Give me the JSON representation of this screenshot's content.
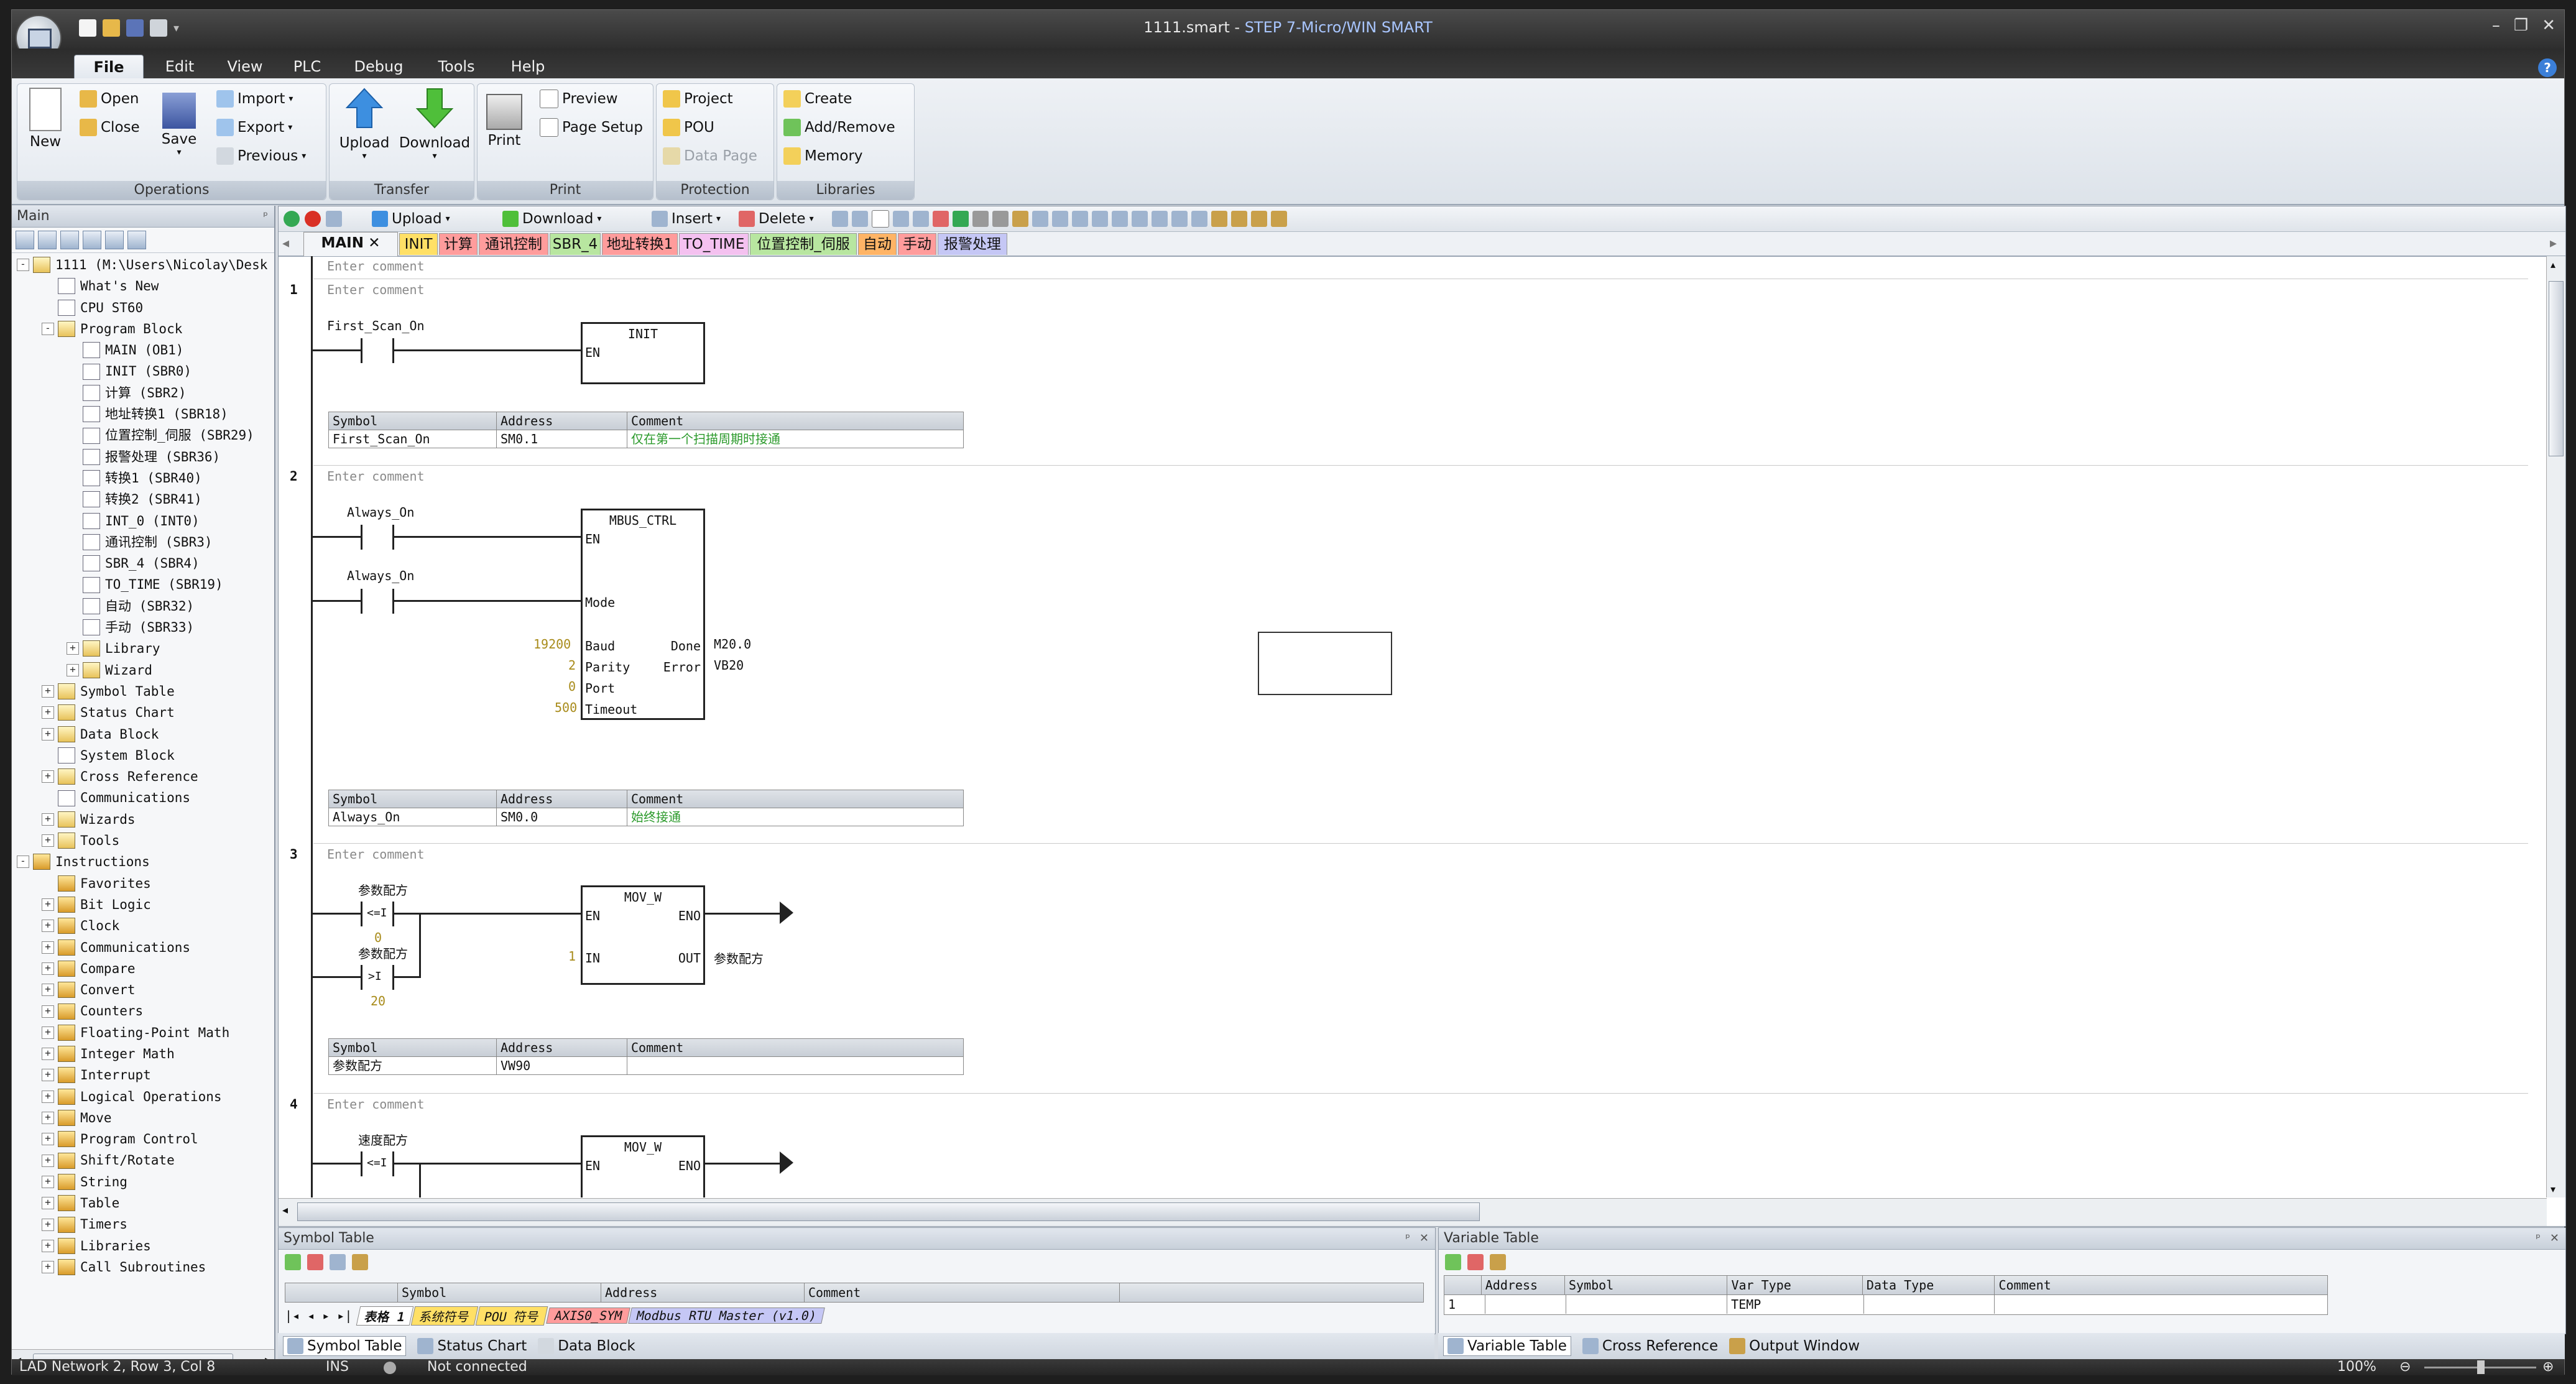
{
  "window": {
    "title_file": "1111.smart",
    "title_sep": " - ",
    "title_app": "STEP 7-Micro/WIN SMART",
    "controls": [
      "–",
      "❐",
      "✕"
    ]
  },
  "menu_tabs": [
    "File",
    "Edit",
    "View",
    "PLC",
    "Debug",
    "Tools",
    "Help"
  ],
  "ribbon": {
    "groups": [
      {
        "label": "Operations"
      },
      {
        "label": "Transfer"
      },
      {
        "label": "Print"
      },
      {
        "label": "Protection"
      },
      {
        "label": "Libraries"
      }
    ],
    "new": "New",
    "open": "Open",
    "close": "Close",
    "save": "Save",
    "import": "Import",
    "export": "Export",
    "previous": "Previous",
    "upload": "Upload",
    "download": "Download",
    "print": "Print",
    "preview": "Preview",
    "page_setup": "Page Setup",
    "project": "Project",
    "pou": "POU",
    "data_page": "Data Page",
    "create": "Create",
    "add_remove": "Add/Remove",
    "memory": "Memory"
  },
  "left_panel": {
    "title": "Main",
    "pin": "ᵖ"
  },
  "tree": [
    {
      "t": "1111 (M:\\Users\\Nicolay\\Desk",
      "d": 0,
      "x": "-",
      "i": "proj"
    },
    {
      "t": "What's New",
      "d": 1,
      "i": "doc"
    },
    {
      "t": "CPU ST60",
      "d": 1,
      "i": "doc"
    },
    {
      "t": "Program Block",
      "d": 1,
      "x": "-",
      "i": "f"
    },
    {
      "t": "MAIN (OB1)",
      "d": 2,
      "i": "doc"
    },
    {
      "t": "INIT (SBR0)",
      "d": 2,
      "i": "doc"
    },
    {
      "t": "计算 (SBR2)",
      "d": 2,
      "i": "doc"
    },
    {
      "t": "地址转换1 (SBR18)",
      "d": 2,
      "i": "doc"
    },
    {
      "t": "位置控制_伺服 (SBR29)",
      "d": 2,
      "i": "doc"
    },
    {
      "t": "报警处理 (SBR36)",
      "d": 2,
      "i": "doc"
    },
    {
      "t": "转换1 (SBR40)",
      "d": 2,
      "i": "doc"
    },
    {
      "t": "转换2 (SBR41)",
      "d": 2,
      "i": "doc"
    },
    {
      "t": "INT_0 (INT0)",
      "d": 2,
      "i": "doc"
    },
    {
      "t": "通讯控制 (SBR3)",
      "d": 2,
      "i": "doc"
    },
    {
      "t": "SBR_4 (SBR4)",
      "d": 2,
      "i": "doc"
    },
    {
      "t": "TO_TIME (SBR19)",
      "d": 2,
      "i": "doc"
    },
    {
      "t": "自动 (SBR32)",
      "d": 2,
      "i": "doc"
    },
    {
      "t": "手动 (SBR33)",
      "d": 2,
      "i": "doc"
    },
    {
      "t": "Library",
      "d": 2,
      "x": "+",
      "i": "f"
    },
    {
      "t": "Wizard",
      "d": 2,
      "x": "+",
      "i": "f"
    },
    {
      "t": "Symbol Table",
      "d": 1,
      "x": "+",
      "i": "f"
    },
    {
      "t": "Status Chart",
      "d": 1,
      "x": "+",
      "i": "f"
    },
    {
      "t": "Data Block",
      "d": 1,
      "x": "+",
      "i": "f"
    },
    {
      "t": "System Block",
      "d": 1,
      "i": "doc"
    },
    {
      "t": "Cross Reference",
      "d": 1,
      "x": "+",
      "i": "f"
    },
    {
      "t": "Communications",
      "d": 1,
      "i": "doc"
    },
    {
      "t": "Wizards",
      "d": 1,
      "x": "+",
      "i": "f"
    },
    {
      "t": "Tools",
      "d": 1,
      "x": "+",
      "i": "f"
    },
    {
      "t": "Instructions",
      "d": 0,
      "x": "-",
      "i": "ins"
    },
    {
      "t": "Favorites",
      "d": 1,
      "i": "ins"
    },
    {
      "t": "Bit Logic",
      "d": 1,
      "x": "+",
      "i": "ins"
    },
    {
      "t": "Clock",
      "d": 1,
      "x": "+",
      "i": "ins"
    },
    {
      "t": "Communications",
      "d": 1,
      "x": "+",
      "i": "ins"
    },
    {
      "t": "Compare",
      "d": 1,
      "x": "+",
      "i": "ins"
    },
    {
      "t": "Convert",
      "d": 1,
      "x": "+",
      "i": "ins"
    },
    {
      "t": "Counters",
      "d": 1,
      "x": "+",
      "i": "ins"
    },
    {
      "t": "Floating-Point Math",
      "d": 1,
      "x": "+",
      "i": "ins"
    },
    {
      "t": "Integer Math",
      "d": 1,
      "x": "+",
      "i": "ins"
    },
    {
      "t": "Interrupt",
      "d": 1,
      "x": "+",
      "i": "ins"
    },
    {
      "t": "Logical Operations",
      "d": 1,
      "x": "+",
      "i": "ins"
    },
    {
      "t": "Move",
      "d": 1,
      "x": "+",
      "i": "ins"
    },
    {
      "t": "Program Control",
      "d": 1,
      "x": "+",
      "i": "ins"
    },
    {
      "t": "Shift/Rotate",
      "d": 1,
      "x": "+",
      "i": "ins"
    },
    {
      "t": "String",
      "d": 1,
      "x": "+",
      "i": "ins"
    },
    {
      "t": "Table",
      "d": 1,
      "x": "+",
      "i": "ins"
    },
    {
      "t": "Timers",
      "d": 1,
      "x": "+",
      "i": "ins"
    },
    {
      "t": "Libraries",
      "d": 1,
      "x": "+",
      "i": "ins"
    },
    {
      "t": "Call Subroutines",
      "d": 1,
      "x": "+",
      "i": "ins"
    }
  ],
  "editor_toolbar": {
    "upload": "Upload",
    "download": "Download",
    "insert": "Insert",
    "delete": "Delete"
  },
  "pou_tabs": [
    {
      "label": "MAIN",
      "color": "#f3f5f8",
      "active": true
    },
    {
      "label": "INIT",
      "color": "#ffe066"
    },
    {
      "label": "计算",
      "color": "#ff9c9c"
    },
    {
      "label": "通讯控制",
      "color": "#ff9c9c"
    },
    {
      "label": "SBR_4",
      "color": "#b8e6a0"
    },
    {
      "label": "地址转换1",
      "color": "#ff9c9c"
    },
    {
      "label": "TO_TIME",
      "color": "#f4c1f0"
    },
    {
      "label": "位置控制_伺服",
      "color": "#b8e6a0"
    },
    {
      "label": "自动",
      "color": "#ffb466"
    },
    {
      "label": "手动",
      "color": "#ff9c9c"
    },
    {
      "label": "报警处理",
      "color": "#c5c7f5"
    }
  ],
  "ladder": {
    "comment_placeholder": "Enter comment",
    "n1": {
      "num": "1",
      "contact": "First_Scan_On",
      "box": "INIT",
      "en": "EN"
    },
    "n2": {
      "num": "2",
      "c1": "Always_On",
      "c2": "Always_On",
      "box": "MBUS_CTRL",
      "en": "EN",
      "mode": "Mode",
      "baud": "Baud",
      "parity": "Parity",
      "port": "Port",
      "timeout": "Timeout",
      "done": "Done",
      "error": "Error",
      "baud_v": "19200",
      "parity_v": "2",
      "port_v": "0",
      "timeout_v": "500",
      "done_v": "M20.0",
      "error_v": "VB20"
    },
    "n3": {
      "num": "3",
      "c1": "参数配方",
      "c1op": "<=I",
      "c1v": "0",
      "c2": "参数配方",
      "c2op": ">I",
      "c2v": "20",
      "box": "MOV_W",
      "en": "EN",
      "eno": "ENO",
      "in": "IN",
      "out": "OUT",
      "in_v": "1",
      "out_v": "参数配方"
    },
    "n4": {
      "num": "4",
      "c1": "速度配方",
      "c1op": "<=I",
      "box": "MOV_W",
      "en": "EN",
      "eno": "ENO"
    },
    "sym_headers": [
      "Symbol",
      "Address",
      "Comment"
    ],
    "sym1": [
      "First_Scan_On",
      "SM0.1",
      "仅在第一个扫描周期时接通"
    ],
    "sym2": [
      "Always_On",
      "SM0.0",
      "始终接通"
    ],
    "sym3": [
      "参数配方",
      "VW90",
      ""
    ]
  },
  "symbol_panel": {
    "title": "Symbol Table",
    "headers": [
      "Symbol",
      "Address",
      "Comment"
    ],
    "sheets": [
      "表格 1",
      "系统符号",
      "POU 符号",
      "AXIS0_SYM",
      "Modbus RTU Master (v1.0)"
    ]
  },
  "variable_panel": {
    "title": "Variable Table",
    "headers": [
      "Address",
      "Symbol",
      "Var Type",
      "Data Type",
      "Comment"
    ],
    "row": [
      "1",
      "",
      "",
      "TEMP",
      "",
      ""
    ]
  },
  "bottom_tabs_left": [
    "Symbol Table",
    "Status Chart",
    "Data Block"
  ],
  "bottom_tabs_right": [
    "Variable Table",
    "Cross Reference",
    "Output Window"
  ],
  "status": {
    "position": "LAD Network 2, Row 3, Col 8",
    "mode": "INS",
    "connection": "Not connected",
    "zoom": "100%"
  }
}
